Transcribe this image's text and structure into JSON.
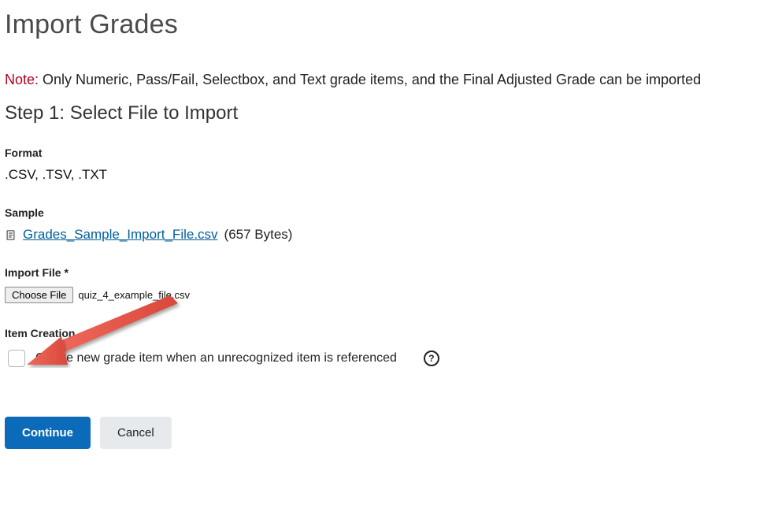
{
  "page": {
    "title": "Import Grades",
    "note_label": "Note:",
    "note_text": "Only Numeric, Pass/Fail, Selectbox, and Text grade items, and the Final Adjusted Grade can be imported",
    "step_title": "Step 1: Select File to Import"
  },
  "format": {
    "label": "Format",
    "value": ".CSV, .TSV, .TXT"
  },
  "sample": {
    "label": "Sample",
    "link_text": "Grades_Sample_Import_File.csv",
    "size_text": "(657 Bytes)"
  },
  "import_file": {
    "label": "Import File *",
    "button_label": "Choose File",
    "chosen_name": "quiz_4_example_file.csv"
  },
  "item_creation": {
    "label": "Item Creation",
    "checkbox_label": "Create new grade item when an unrecognized item is referenced",
    "help_glyph": "?"
  },
  "actions": {
    "continue": "Continue",
    "cancel": "Cancel"
  },
  "colors": {
    "accent": "#0c6bb8",
    "note": "#b00020",
    "arrow": "#e85a4f"
  }
}
